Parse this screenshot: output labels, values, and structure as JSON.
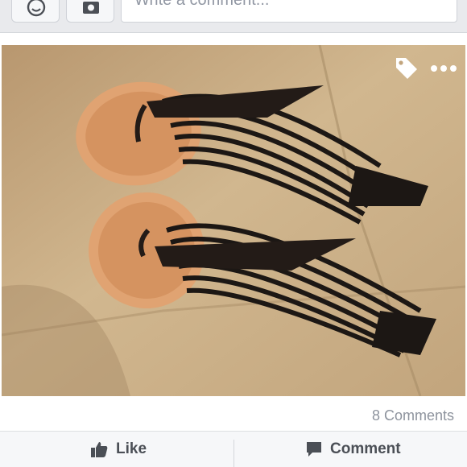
{
  "composer": {
    "placeholder": "Write a comment..."
  },
  "post": {
    "comments_count": "8 Comments"
  },
  "actions": {
    "like_label": "Like",
    "comment_label": "Comment"
  },
  "colors": {
    "icon_gray": "#4b4f56",
    "muted_text": "#8d939d"
  }
}
